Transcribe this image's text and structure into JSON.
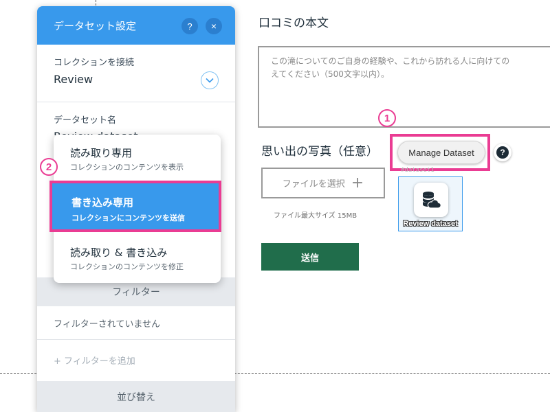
{
  "review_section": {
    "title": "口コミの本文",
    "placeholder": "この滝についてのご自身の経験や、これから訪れる人に向けての え てください（500文字以内）。",
    "placeholder_line1": "この滝についてのご自身の経験や、これから訪れる人に向けての",
    "placeholder_line2": "えてください（500文字以内）。"
  },
  "photo_section": {
    "title": "思い出の写真（任意）",
    "file_button": "ファイルを選択",
    "file_button_icon": "plus-icon",
    "max_size_note": "ファイル最大サイズ 15MB"
  },
  "submit_label": "送信",
  "manage_dataset": {
    "button_label": "Manage Dataset",
    "help_label": "?",
    "badge": "1"
  },
  "dataset_element": {
    "id_label": "#dataset1",
    "caption": "Review dataset",
    "icon": "database-cloud-icon"
  },
  "panel": {
    "title": "データセット設定",
    "help_label": "?",
    "close_label": "×",
    "collection_label": "コレクションを接続",
    "collection_value": "Review",
    "dataset_name_label": "データセット名",
    "dataset_name_value": "Review dataset",
    "filter_header": "フィルター",
    "filter_status": "フィルターされていません",
    "add_filter": "+ フィルターを追加",
    "sort_header": "並び替え"
  },
  "mode_menu": {
    "badge": "2",
    "selected_index": 1,
    "items": [
      {
        "title": "読み取り専用",
        "subtitle": "コレクションのコンテンツを表示"
      },
      {
        "title": "書き込み専用",
        "subtitle": "コレクションにコンテンツを送信"
      },
      {
        "title": "読み取り & 書き込み",
        "subtitle": "コレクションのコンテンツを修正"
      }
    ]
  },
  "colors": {
    "panel_header": "#3899ec",
    "highlight": "#ea3c93",
    "submit": "#206d4b"
  }
}
